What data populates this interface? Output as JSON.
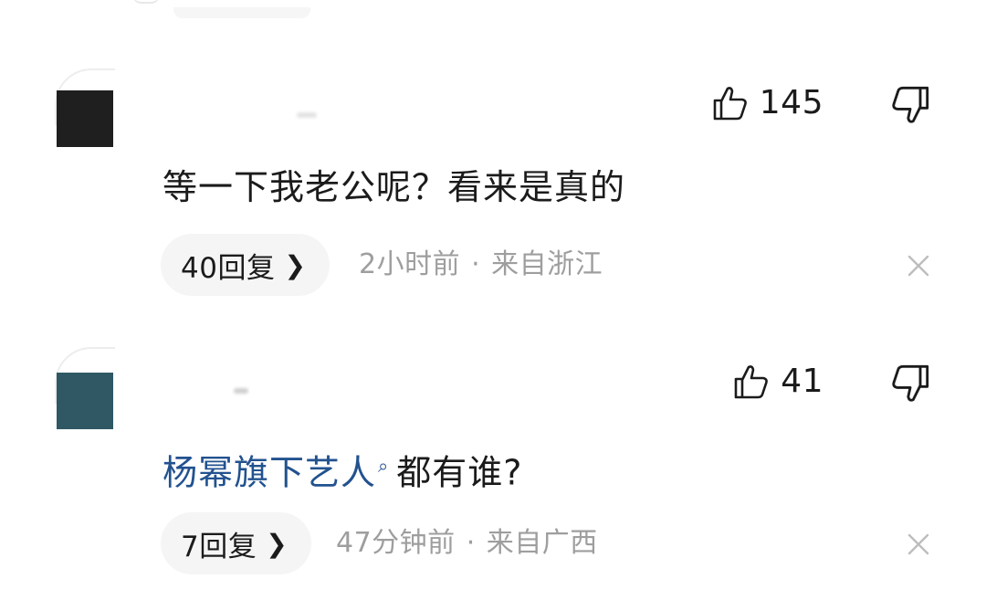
{
  "comments": [
    {
      "like_count": "145",
      "text": "等一下我老公呢？看来是真的",
      "reply_label": "40回复",
      "time": "2小时前",
      "separator": "·",
      "location": "来自浙江"
    },
    {
      "like_count": "41",
      "link_text": "杨幂旗下艺人",
      "link_icon": "search-icon",
      "text": "都有谁?",
      "reply_label": "7回复",
      "time": "47分钟前",
      "separator": "·",
      "location": "来自广西"
    }
  ],
  "icons": {
    "like": "thumbs-up-icon",
    "dislike": "thumbs-down-icon",
    "close": "close-icon",
    "reply_arrow": "chevron-right-icon"
  },
  "colors": {
    "link": "#22528f",
    "meta_gray": "#9e9e9e",
    "text": "#1b1b1b",
    "pill_bg": "#f5f5f5"
  }
}
